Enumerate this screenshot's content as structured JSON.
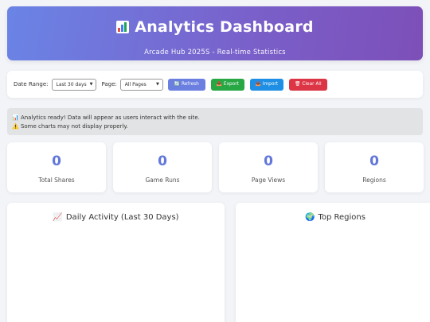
{
  "header": {
    "title": "Analytics Dashboard",
    "subtitle": "Arcade Hub 2025S - Real-time Statistics"
  },
  "toolbar": {
    "date_range_label": "Date Range:",
    "date_range_value": "Last 30 days",
    "page_label": "Page:",
    "page_value": "All Pages",
    "refresh_label": "Refresh",
    "export_label": "Export",
    "import_label": "Import",
    "clear_label": "Clear All"
  },
  "notice": {
    "line1": "Analytics ready! Data will appear as users interact with the site.",
    "line2": "Some charts may not display properly."
  },
  "stats": [
    {
      "value": "0",
      "label": "Total Shares"
    },
    {
      "value": "0",
      "label": "Game Runs"
    },
    {
      "value": "0",
      "label": "Page Views"
    },
    {
      "value": "0",
      "label": "Regions"
    }
  ],
  "panels": {
    "daily_activity_title": "Daily Activity (Last 30 Days)",
    "top_regions_title": "Top Regions"
  },
  "colors": {
    "accent": "#6277d9",
    "refresh": "#6b7fe0",
    "export": "#28a745",
    "import": "#1e8fe4",
    "clear": "#dc3545"
  },
  "icons": {
    "header": "bar-chart-icon",
    "refresh": "refresh-icon",
    "export": "export-icon",
    "import": "import-icon",
    "clear": "trash-icon",
    "notice_info": "bar-chart-icon",
    "notice_warning": "warning-icon",
    "daily_activity": "line-chart-icon",
    "top_regions": "globe-icon"
  }
}
